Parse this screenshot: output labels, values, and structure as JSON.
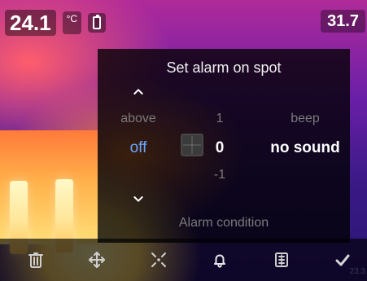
{
  "status": {
    "spot_temperature": "24.1",
    "unit": "°C",
    "top_right_value": "31.7"
  },
  "dialog": {
    "title": "Set alarm on spot",
    "columns": {
      "condition": {
        "above": "above",
        "current": "off"
      },
      "threshold": {
        "above": "1",
        "current": "0",
        "below": "-1"
      },
      "sound": {
        "above": "beep",
        "current": "no sound"
      }
    },
    "footer_label": "Alarm condition"
  },
  "toolbar": {
    "icons": [
      "trash-icon",
      "move-icon",
      "spot-icon",
      "bell-icon",
      "grid-icon",
      "check-icon"
    ],
    "faint_value": "23.3"
  },
  "colors": {
    "accent_blue": "#6aa6ff",
    "dialog_bg": "rgba(0,0,0,0.78)"
  }
}
